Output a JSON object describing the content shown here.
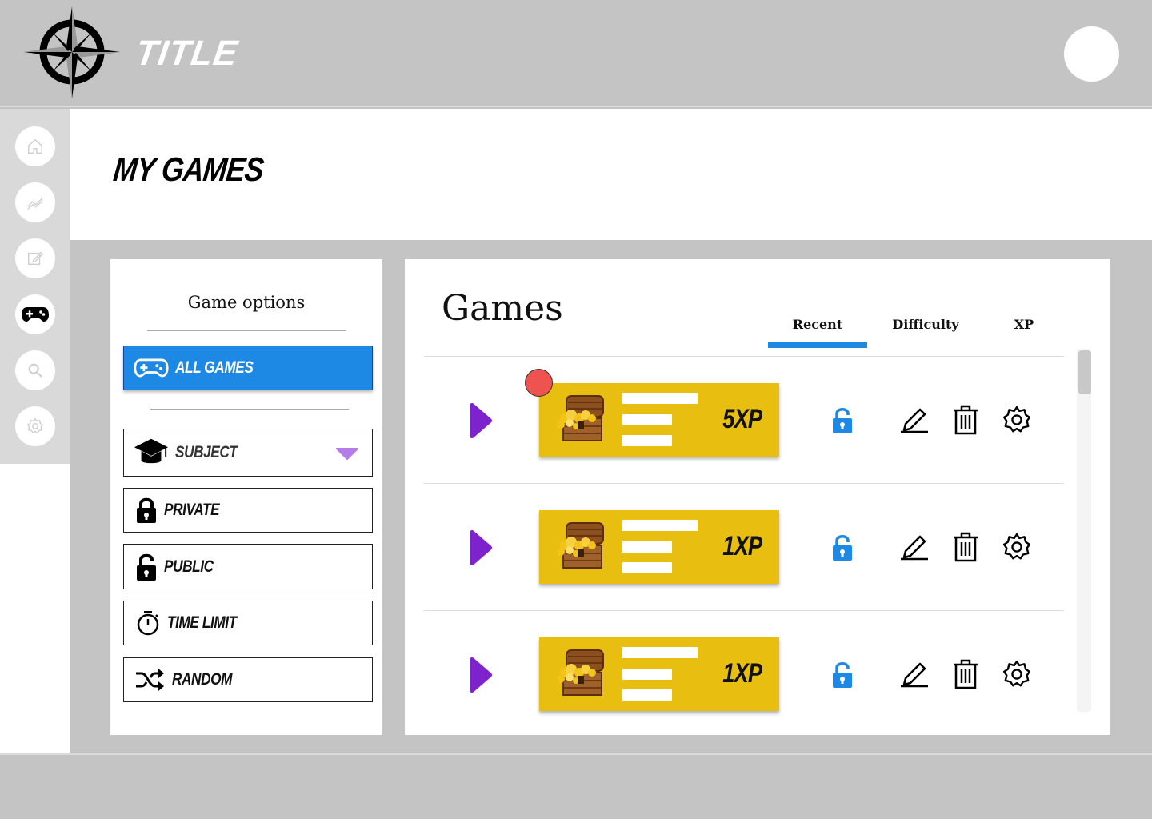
{
  "header": {
    "title": "TITLE"
  },
  "page": {
    "title": "MY GAMES"
  },
  "sidebar": {
    "items": [
      {
        "icon": "home-icon"
      },
      {
        "icon": "chart-icon"
      },
      {
        "icon": "edit-icon"
      },
      {
        "icon": "gamepad-icon",
        "active": true
      },
      {
        "icon": "search-icon"
      },
      {
        "icon": "settings-icon"
      }
    ]
  },
  "options": {
    "title": "Game options",
    "all_games": "ALL GAMES",
    "subject": "SUBJECT",
    "private": "PRIVATE",
    "public": "PUBLIC",
    "time_limit": "TIME LIMIT",
    "random": "RANDOM"
  },
  "games": {
    "title": "Games",
    "tabs": [
      "Recent",
      "Difficulty",
      "XP"
    ],
    "active_tab": "Recent",
    "rows": [
      {
        "xp": "5XP"
      },
      {
        "xp": "1XP"
      },
      {
        "xp": "1XP"
      }
    ]
  },
  "colors": {
    "accent": "#1e88e5",
    "card": "#e8be10",
    "play": "#7e22ce",
    "notification": "#ef5350"
  }
}
